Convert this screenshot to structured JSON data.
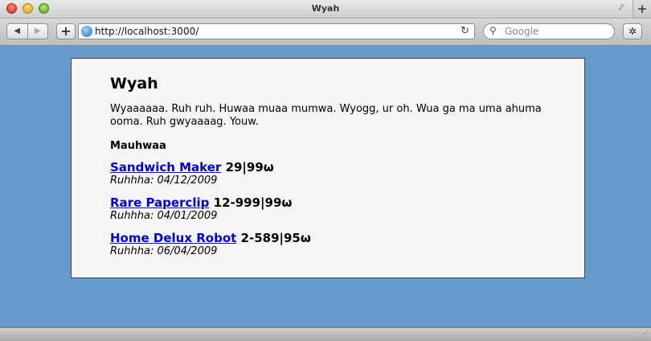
{
  "window": {
    "title": "Wyah"
  },
  "toolbar": {
    "back_glyph": "◀",
    "forward_glyph": "▶",
    "add_glyph": "+",
    "url": "http://localhost:3000/",
    "reload_glyph": "↻",
    "search_placeholder": "Google",
    "search_glyph": "⚲",
    "bug_glyph": "✲",
    "newtab_glyph": "+"
  },
  "page": {
    "title": "Wyah",
    "intro": "Wyaaaaaa. Ruh ruh. Huwaa muaa mumwa. Wyogg, ur oh. Wua ga ma uma ahuma ooma. Ruh gwyaaaag. Youw.",
    "section_title": "Mauhwaa",
    "products": [
      {
        "name": "Sandwich Maker",
        "price": "29|99ω",
        "date_label": "Ruhhha: 04/12/2009"
      },
      {
        "name": "Rare Paperclip",
        "price": "12-999|99ω",
        "date_label": "Ruhhha: 04/01/2009"
      },
      {
        "name": "Home Delux Robot",
        "price": "2-589|95ω",
        "date_label": "Ruhhha: 06/04/2009"
      }
    ]
  },
  "colors": {
    "page_background": "#6699cc",
    "link": "#0000cc",
    "container_background": "#f5f5f5"
  }
}
